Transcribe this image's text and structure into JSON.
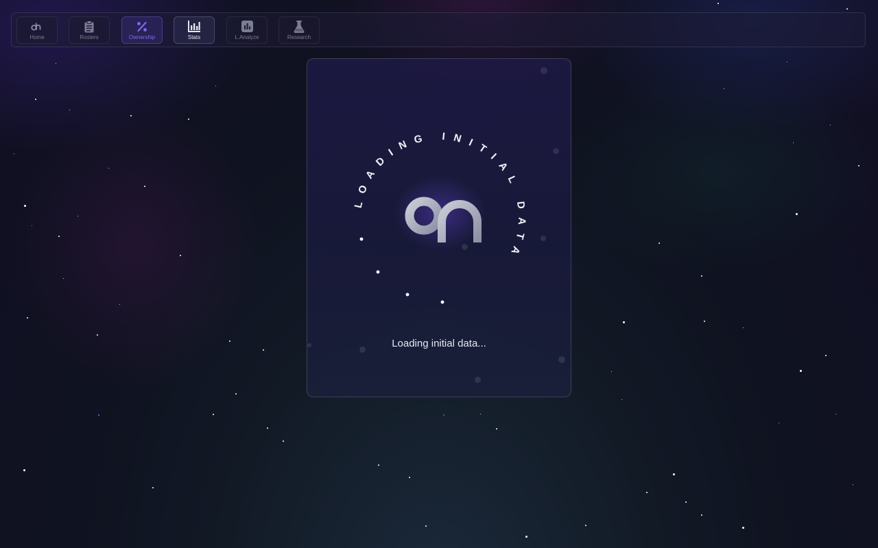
{
  "nav": {
    "items": [
      {
        "label": "Home",
        "icon": "dh-logo-icon",
        "state": "normal"
      },
      {
        "label": "Rosters",
        "icon": "clipboard-icon",
        "state": "normal"
      },
      {
        "label": "Ownership",
        "icon": "percent-icon",
        "state": "active"
      },
      {
        "label": "Stats",
        "icon": "bar-chart-icon",
        "state": "current"
      },
      {
        "label": "L.Analyze",
        "icon": "chart-box-icon",
        "state": "normal"
      },
      {
        "label": "Research",
        "icon": "flask-icon",
        "state": "normal"
      }
    ]
  },
  "loader": {
    "ring_text": "LOADING INITIAL DATA",
    "status_text": "Loading initial data...",
    "logo_text": "dh"
  },
  "colors": {
    "accent": "#7b6cf0",
    "text_muted": "#7c7d93",
    "text_bright": "#e6e6f0"
  }
}
